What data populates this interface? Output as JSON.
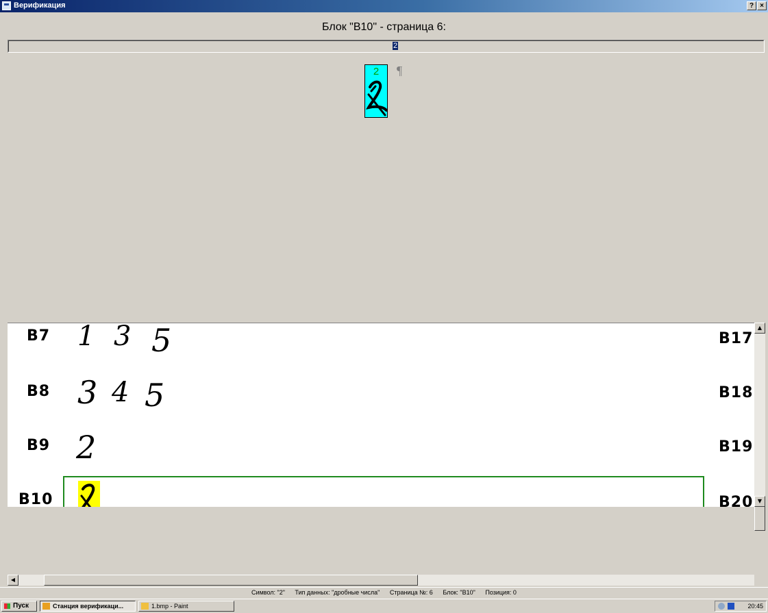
{
  "window": {
    "title": "Верификация",
    "help_btn": "?",
    "close_btn": "×"
  },
  "header": {
    "block_title": "Блок \"В10\" - страница 6:"
  },
  "recognition": {
    "text": "2",
    "cell_char": "2",
    "pilcrow": "¶"
  },
  "image": {
    "left_labels": [
      "B7",
      "B8",
      "B9",
      "B10"
    ],
    "right_labels": [
      "B17",
      "B18",
      "B19",
      "B20"
    ],
    "rows": [
      [
        "1",
        "3",
        "5"
      ],
      [
        "3",
        "4",
        "5"
      ],
      [
        "2"
      ]
    ],
    "active_char": "2"
  },
  "status": {
    "symbol": "Символ: \"2\"",
    "data_type": "Тип данных: \"дробные числа\"",
    "page": "Страница №: 6",
    "block": "Блок: \"В10\"",
    "position": "Позиция: 0"
  },
  "taskbar": {
    "start": "Пуск",
    "tasks": [
      "Станция верификаци...",
      "1.bmp - Paint"
    ],
    "clock": "20:45"
  },
  "colors": {
    "cell_bg": "#00ffff",
    "active_char_bg": "#ffff00",
    "frame": "#1e8a1e",
    "recognized_char": "#00a000"
  }
}
